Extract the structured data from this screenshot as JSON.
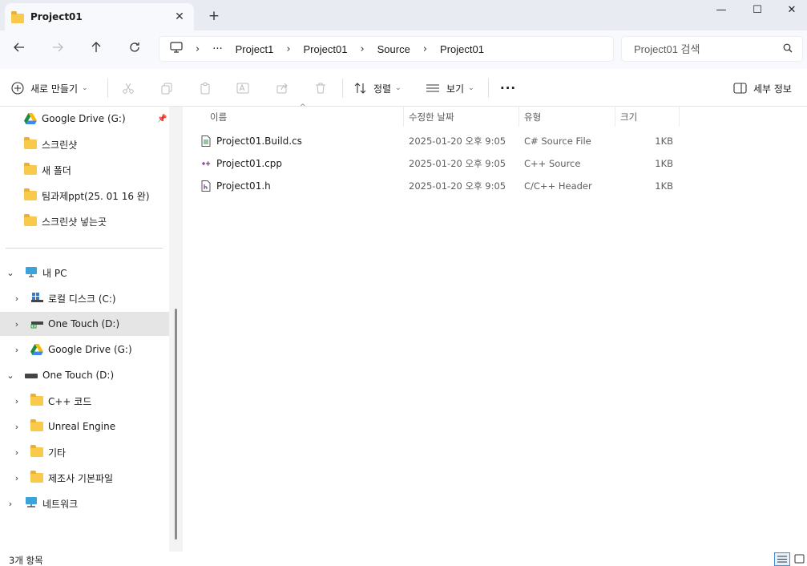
{
  "window": {
    "tab_title": "Project01",
    "new_tab": "+",
    "tab_close": "✕",
    "minimize": "—",
    "maximize": "☐",
    "close": "✕"
  },
  "breadcrumb": {
    "overflow": "···",
    "items": [
      "Project1",
      "Project01",
      "Source",
      "Project01"
    ]
  },
  "search": {
    "placeholder": "Project01 검색"
  },
  "toolbar": {
    "new_label": "새로 만들기",
    "sort_label": "정렬",
    "view_label": "보기",
    "more_label": "···",
    "details_label": "세부 정보"
  },
  "sidebar": {
    "quick": [
      {
        "label": "Google Drive (G:)",
        "icon": "google-drive-icon"
      },
      {
        "label": "스크린샷",
        "icon": "folder-icon"
      },
      {
        "label": "새 폴더",
        "icon": "folder-icon"
      },
      {
        "label": "팀과제ppt(25. 01 16 완)",
        "icon": "folder-icon"
      },
      {
        "label": "스크린샷 넣는곳",
        "icon": "folder-icon"
      }
    ],
    "tree": [
      {
        "label": "내 PC",
        "level": 0,
        "expanded": true
      },
      {
        "label": "로컬 디스크 (C:)",
        "level": 1
      },
      {
        "label": "One Touch (D:)",
        "level": 1,
        "selected": true
      },
      {
        "label": "Google Drive (G:)",
        "level": 1
      },
      {
        "label": "One Touch (D:)",
        "level": 0,
        "expanded": true
      },
      {
        "label": "C++ 코드",
        "level": 1
      },
      {
        "label": "Unreal Engine",
        "level": 1
      },
      {
        "label": "기타",
        "level": 1
      },
      {
        "label": "제조사 기본파일",
        "level": 1
      },
      {
        "label": "네트워크",
        "level": 0
      }
    ]
  },
  "columns": [
    "이름",
    "수정한 날짜",
    "유형",
    "크기"
  ],
  "files": [
    {
      "name": "Project01.Build.cs",
      "date": "2025-01-20 오후 9:05",
      "type": "C# Source File",
      "size": "1KB",
      "icon": "cs-file-icon"
    },
    {
      "name": "Project01.cpp",
      "date": "2025-01-20 오후 9:05",
      "type": "C++ Source",
      "size": "1KB",
      "icon": "cpp-file-icon"
    },
    {
      "name": "Project01.h",
      "date": "2025-01-20 오후 9:05",
      "type": "C/C++ Header",
      "size": "1KB",
      "icon": "header-file-icon"
    }
  ],
  "status": {
    "item_count": "3개 항목"
  },
  "colors": {
    "folder": "#f8c94a",
    "selected": "#e5e5e5",
    "titlebar": "#e8ebf1"
  }
}
